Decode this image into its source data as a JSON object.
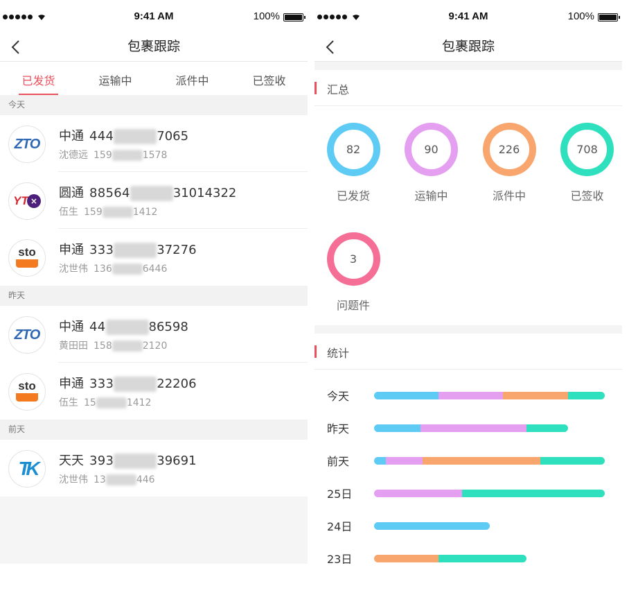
{
  "status": {
    "time": "9:41 AM",
    "battery": "100%"
  },
  "left": {
    "title": "包裹跟踪",
    "tabs": [
      {
        "label": "已发货",
        "active": true
      },
      {
        "label": "运输中",
        "active": false
      },
      {
        "label": "派件中",
        "active": false
      },
      {
        "label": "已签收",
        "active": false
      }
    ],
    "groups": [
      {
        "label": "今天",
        "items": [
          {
            "courier": "中通",
            "logo": "zto-logo",
            "num_prefix": "444",
            "num_suffix": "7065",
            "name": "沈德远",
            "phone_prefix": "159",
            "phone_suffix": "1578"
          },
          {
            "courier": "圆通",
            "logo": "yto-logo",
            "num_prefix": "88564",
            "num_suffix": "31014322",
            "name": "伍生",
            "phone_prefix": "159",
            "phone_suffix": "1412"
          },
          {
            "courier": "申通",
            "logo": "sto-logo",
            "num_prefix": "333",
            "num_suffix": "37276",
            "name": "沈世伟",
            "phone_prefix": "136",
            "phone_suffix": "6446"
          }
        ]
      },
      {
        "label": "昨天",
        "items": [
          {
            "courier": "中通",
            "logo": "zto-logo",
            "num_prefix": "44",
            "num_suffix": "86598",
            "name": "黄田田",
            "phone_prefix": "158",
            "phone_suffix": "2120"
          },
          {
            "courier": "申通",
            "logo": "sto-logo",
            "num_prefix": "333",
            "num_suffix": "22206",
            "name": "伍生",
            "phone_prefix": "15",
            "phone_suffix": "1412"
          }
        ]
      },
      {
        "label": "前天",
        "items": [
          {
            "courier": "天天",
            "logo": "tt-logo",
            "num_prefix": "393",
            "num_suffix": "39691",
            "name": "沈世伟",
            "phone_prefix": "13",
            "phone_suffix": "446"
          }
        ]
      }
    ]
  },
  "right": {
    "title": "包裹跟踪",
    "summary_label": "汇总",
    "stats_label": "统计",
    "colors": {
      "shipped": "#5ecbf5",
      "transit": "#e49ff0",
      "delivering": "#f8a66e",
      "signed": "#2ee0bd",
      "problem": "#f46e96"
    },
    "summary": [
      {
        "key": "shipped",
        "value": "82",
        "label": "已发货"
      },
      {
        "key": "transit",
        "value": "90",
        "label": "运输中"
      },
      {
        "key": "delivering",
        "value": "226",
        "label": "派件中"
      },
      {
        "key": "signed",
        "value": "708",
        "label": "已签收"
      },
      {
        "key": "problem",
        "value": "3",
        "label": "问题件"
      }
    ],
    "chart_data": {
      "type": "bar",
      "orientation": "horizontal-stacked",
      "categories": [
        "今天",
        "昨天",
        "前天",
        "25日",
        "24日",
        "23日"
      ],
      "series": [
        {
          "key": "shipped",
          "values": [
            0.28,
            0.2,
            0.05,
            0,
            0.5,
            0
          ]
        },
        {
          "key": "transit",
          "values": [
            0.28,
            0.46,
            0.16,
            0.38,
            0,
            0
          ]
        },
        {
          "key": "delivering",
          "values": [
            0.28,
            0,
            0.51,
            0,
            0,
            0.28
          ]
        },
        {
          "key": "signed",
          "values": [
            0.16,
            0.18,
            0.28,
            0.62,
            0,
            0.38
          ]
        }
      ],
      "xlim": [
        0,
        1
      ]
    }
  }
}
